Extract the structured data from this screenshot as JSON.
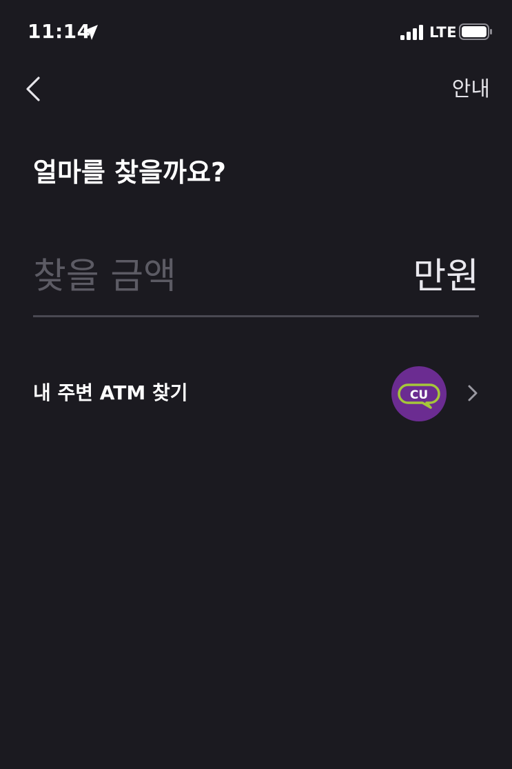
{
  "status_bar": {
    "time": "11:14",
    "network": "LTE",
    "icons": [
      "location-icon",
      "signal-icon",
      "battery-icon"
    ]
  },
  "nav": {
    "back_icon": "chevron-left-icon",
    "info_label": "안내"
  },
  "title": "얼마를 찾을까요?",
  "amount": {
    "placeholder": "찾을 금액",
    "value": "",
    "unit": "만원"
  },
  "atm": {
    "label": "내 주변 ATM 찾기",
    "partner_logo": "CU",
    "logo_color": "#6b2c91",
    "logo_accent": "#a6c63a"
  },
  "colors": {
    "background": "#1b1a20",
    "divider": "#4a4952",
    "placeholder": "#5c5b64",
    "text": "#ffffff"
  }
}
